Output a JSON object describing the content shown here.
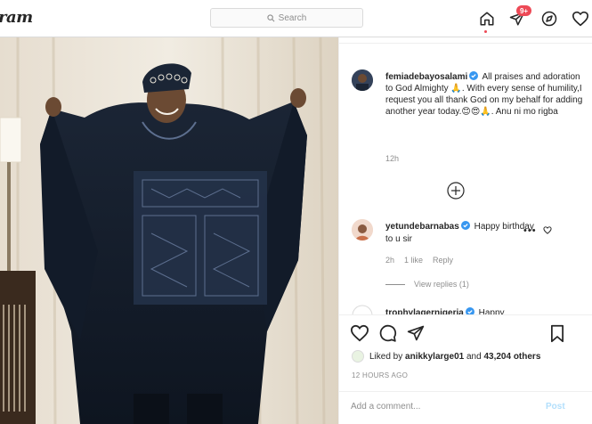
{
  "topbar": {
    "logo_text": "ram",
    "search_placeholder": "Search",
    "notification_badge": "9+"
  },
  "post": {
    "author": {
      "username": "femiadebayosalami",
      "verified": true
    },
    "caption_text": "All praises and adoration to God Almighty 🙏. With every sense of humility,I request you all thank God on my behalf for adding another year today.😊😍🙏. Anu ni mo rigba",
    "caption_time": "12h",
    "comments": [
      {
        "username": "yetundebarnabas",
        "verified": true,
        "text": "Happy birthday to u sir",
        "time": "2h",
        "likes": "1 like",
        "reply_label": "Reply",
        "view_replies": "View replies (1)"
      },
      {
        "username": "trophylagernigeria",
        "verified": true,
        "text": "Happy"
      }
    ],
    "liked_by": {
      "prefix": "Liked by",
      "user": "anikkylarge01",
      "and": "and",
      "others": "43,204 others"
    },
    "timestamp": "12 HOURS AGO",
    "add_comment_placeholder": "Add a comment...",
    "post_button": "Post"
  },
  "colors": {
    "accent_red": "#ed4956",
    "verified_blue": "#3897f0",
    "post_button_disabled": "#b2dffc"
  }
}
